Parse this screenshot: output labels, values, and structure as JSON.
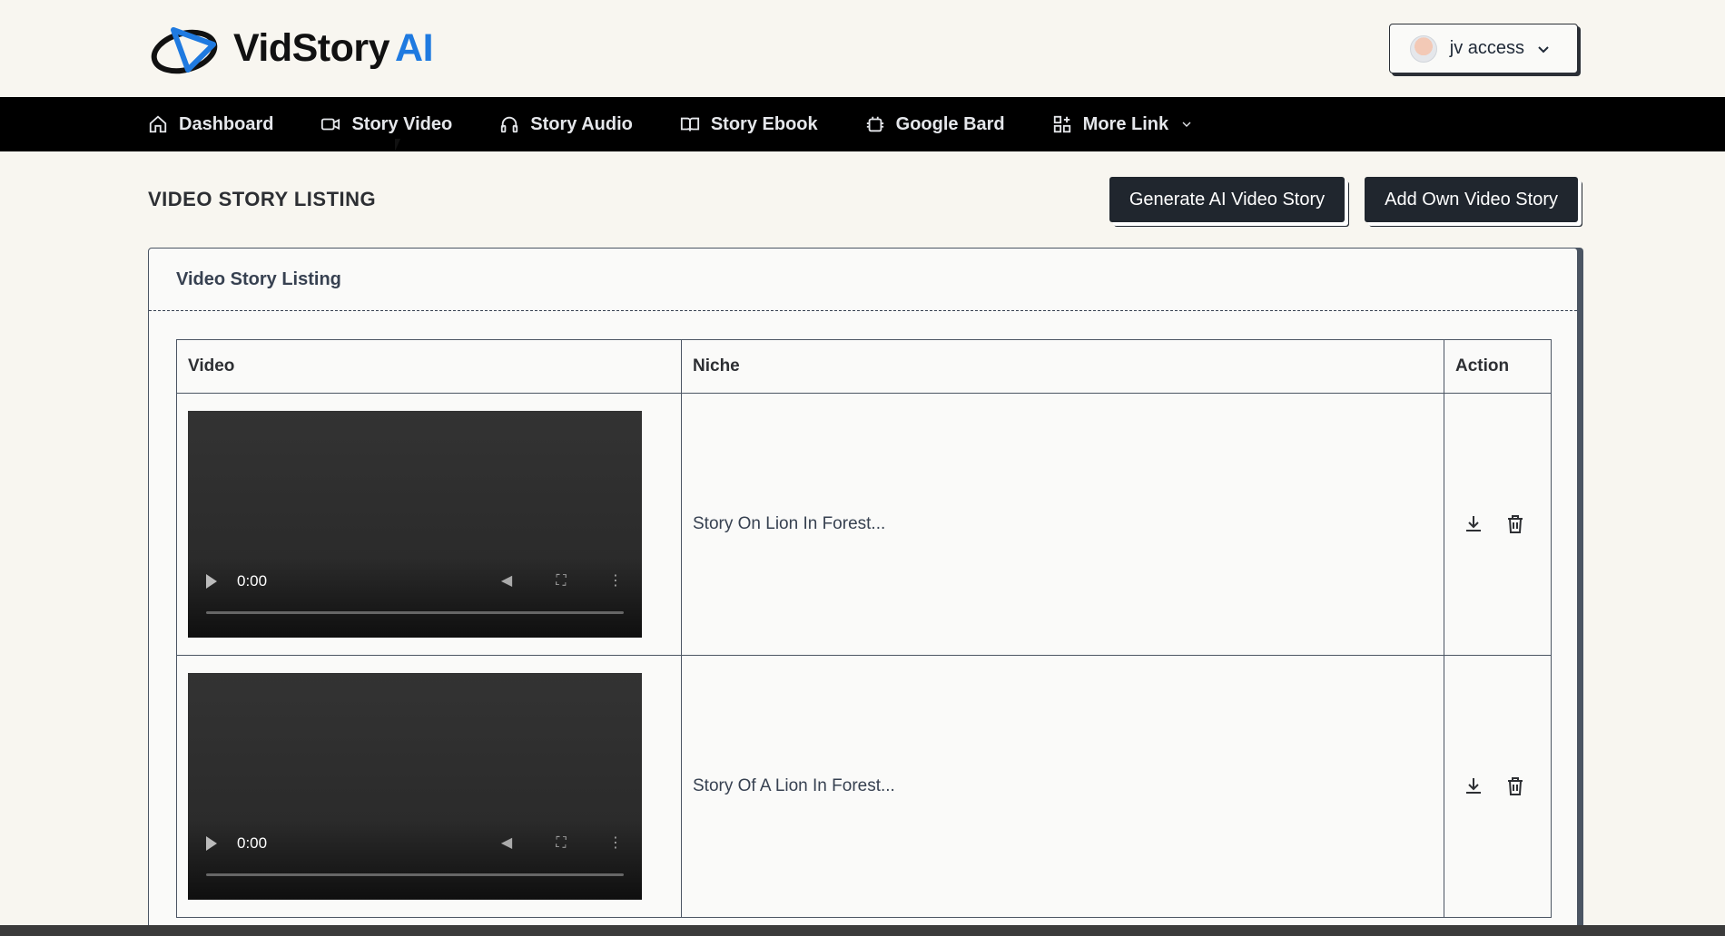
{
  "brand": {
    "name": "VidStory",
    "suffix": "AI"
  },
  "user": {
    "label": "jv access"
  },
  "nav": [
    {
      "label": "Dashboard",
      "icon": "home-icon"
    },
    {
      "label": "Story Video",
      "icon": "video-camera-icon"
    },
    {
      "label": "Story Audio",
      "icon": "headphones-icon"
    },
    {
      "label": "Story Ebook",
      "icon": "book-icon"
    },
    {
      "label": "Google Bard",
      "icon": "robot-icon"
    },
    {
      "label": "More Link",
      "icon": "grid-plus-icon"
    }
  ],
  "page": {
    "title": "VIDEO STORY LISTING",
    "generate_btn": "Generate AI Video Story",
    "add_btn": "Add Own Video Story"
  },
  "card": {
    "title": "Video Story Listing",
    "columns": [
      "Video",
      "Niche",
      "Action"
    ],
    "rows": [
      {
        "time": "0:00",
        "niche": "Story On Lion In Forest..."
      },
      {
        "time": "0:00",
        "niche": "Story Of A Lion In Forest..."
      }
    ]
  },
  "colors": {
    "accent": "#1f7ae0",
    "nav_bg": "#000000",
    "button_bg": "#20262e"
  }
}
